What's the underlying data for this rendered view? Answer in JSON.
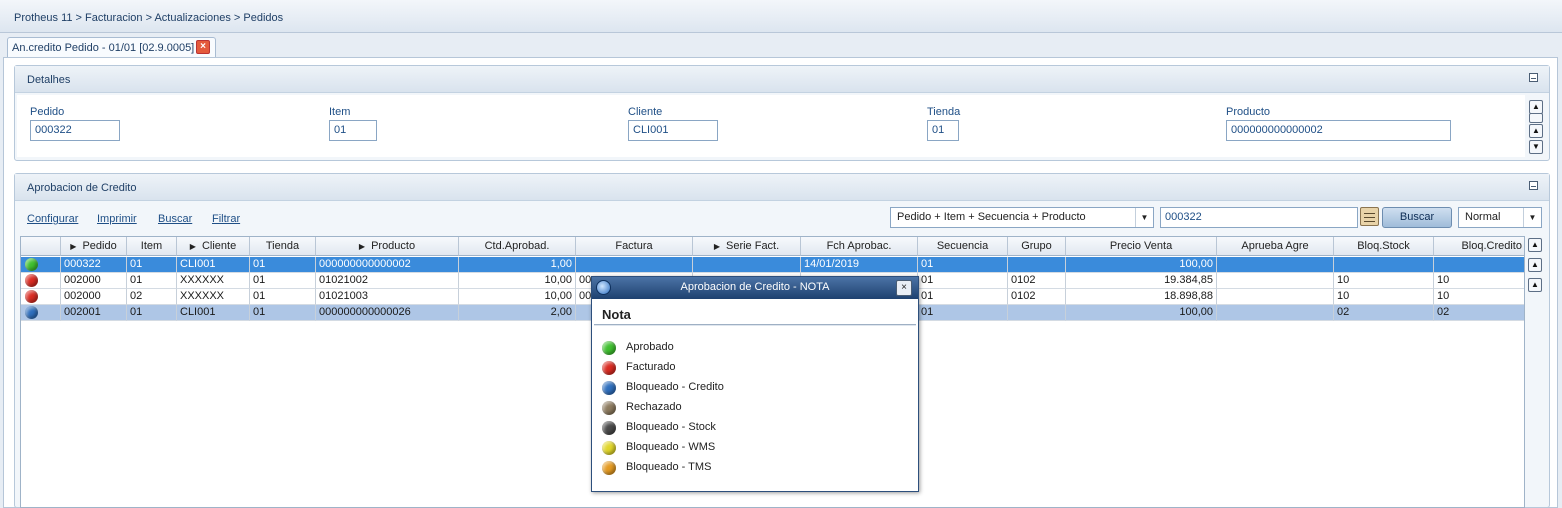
{
  "breadcrumb": "Protheus 11 > Facturacion > Actualizaciones > Pedidos",
  "tab": {
    "label": "An.credito Pedido - 01/01 [02.9.0005]",
    "close": "×"
  },
  "details": {
    "title": "Detalhes",
    "fields": [
      {
        "label": "Pedido",
        "value": "000322"
      },
      {
        "label": "Item",
        "value": "01"
      },
      {
        "label": "Cliente",
        "value": "CLI001"
      },
      {
        "label": "Tienda",
        "value": "01"
      },
      {
        "label": "Producto",
        "value": "000000000000002"
      }
    ]
  },
  "approval": {
    "title": "Aprobacion de Credito",
    "links": [
      "Configurar",
      "Imprimir",
      "Buscar",
      "Filtrar"
    ],
    "search_index": "Pedido + Item + Secuencia + Producto",
    "search_value": "000322",
    "search_button": "Buscar",
    "view_mode": "Normal"
  },
  "grid": {
    "columns": [
      "",
      "Pedido",
      "Item",
      "Cliente",
      "Tienda",
      "Producto",
      "Ctd.Aprobad.",
      "Factura",
      "Serie Fact.",
      "Fch Aprobac.",
      "Secuencia",
      "Grupo",
      "Precio Venta",
      "Aprueba Agre",
      "Bloq.Stock",
      "Bloq.Credito"
    ],
    "rows": [
      {
        "status": "green",
        "cells": [
          "000322",
          "01",
          "CLI001",
          "01",
          "000000000000002",
          "1,00",
          "",
          "",
          "14/01/2019",
          "01",
          "",
          "100,00",
          "",
          "",
          ""
        ]
      },
      {
        "status": "red",
        "cells": [
          "002000",
          "01",
          "XXXXXX",
          "01",
          "01021002",
          "10,00",
          "00",
          "",
          "",
          "01",
          "0102",
          "19.384,85",
          "",
          "10",
          "10"
        ]
      },
      {
        "status": "red",
        "cells": [
          "002000",
          "02",
          "XXXXXX",
          "01",
          "01021003",
          "10,00",
          "00",
          "",
          "",
          "01",
          "0102",
          "18.898,88",
          "",
          "10",
          "10"
        ]
      },
      {
        "status": "blue",
        "cells": [
          "002001",
          "01",
          "CLI001",
          "01",
          "000000000000026",
          "2,00",
          "",
          "",
          "",
          "01",
          "",
          "100,00",
          "",
          "02",
          "02"
        ]
      }
    ]
  },
  "dialog": {
    "title": "Aprobacion de Credito - NOTA",
    "close": "×",
    "heading": "Nota",
    "legend": [
      {
        "label": "Aprobado",
        "color": "#3fbf2f"
      },
      {
        "label": "Facturado",
        "color": "#d92b22"
      },
      {
        "label": "Bloqueado - Credito",
        "color": "#2f6fbd"
      },
      {
        "label": "Rechazado",
        "color": "#8c7a5e"
      },
      {
        "label": "Bloqueado - Stock",
        "color": "#4a4a4a"
      },
      {
        "label": "Bloqueado - WMS",
        "color": "#e0d52a"
      },
      {
        "label": "Bloqueado - TMS",
        "color": "#e39a22"
      }
    ]
  },
  "status_colors": {
    "green": "#3fbf2f",
    "red": "#d92b22",
    "blue": "#2f6fbd"
  }
}
